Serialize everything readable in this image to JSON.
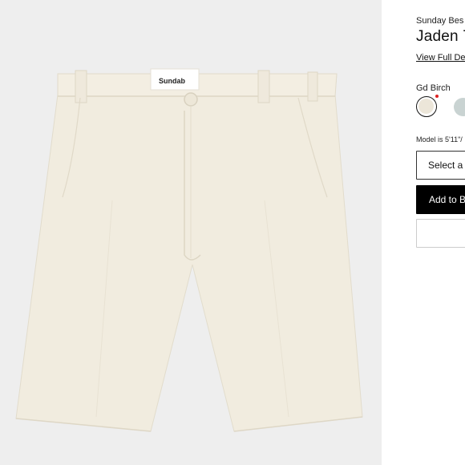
{
  "product": {
    "brand": "Sunday Bes",
    "title": "Jaden 7",
    "view_details_label": "View Full De",
    "label_brand_text": "Sundab"
  },
  "colors": {
    "selected_name": "Gd Birch",
    "swatches": [
      {
        "name": "gd-birch",
        "hex": "#ece6d9",
        "selected": true
      },
      {
        "name": "sage",
        "hex": "#c9d3d2",
        "selected": false
      }
    ],
    "accent_new_marker": "#dd2222"
  },
  "fit": {
    "model_info": "Model is 5'11\"/"
  },
  "actions": {
    "size_select_label": "Select a",
    "add_to_bag_label": "Add to B"
  }
}
